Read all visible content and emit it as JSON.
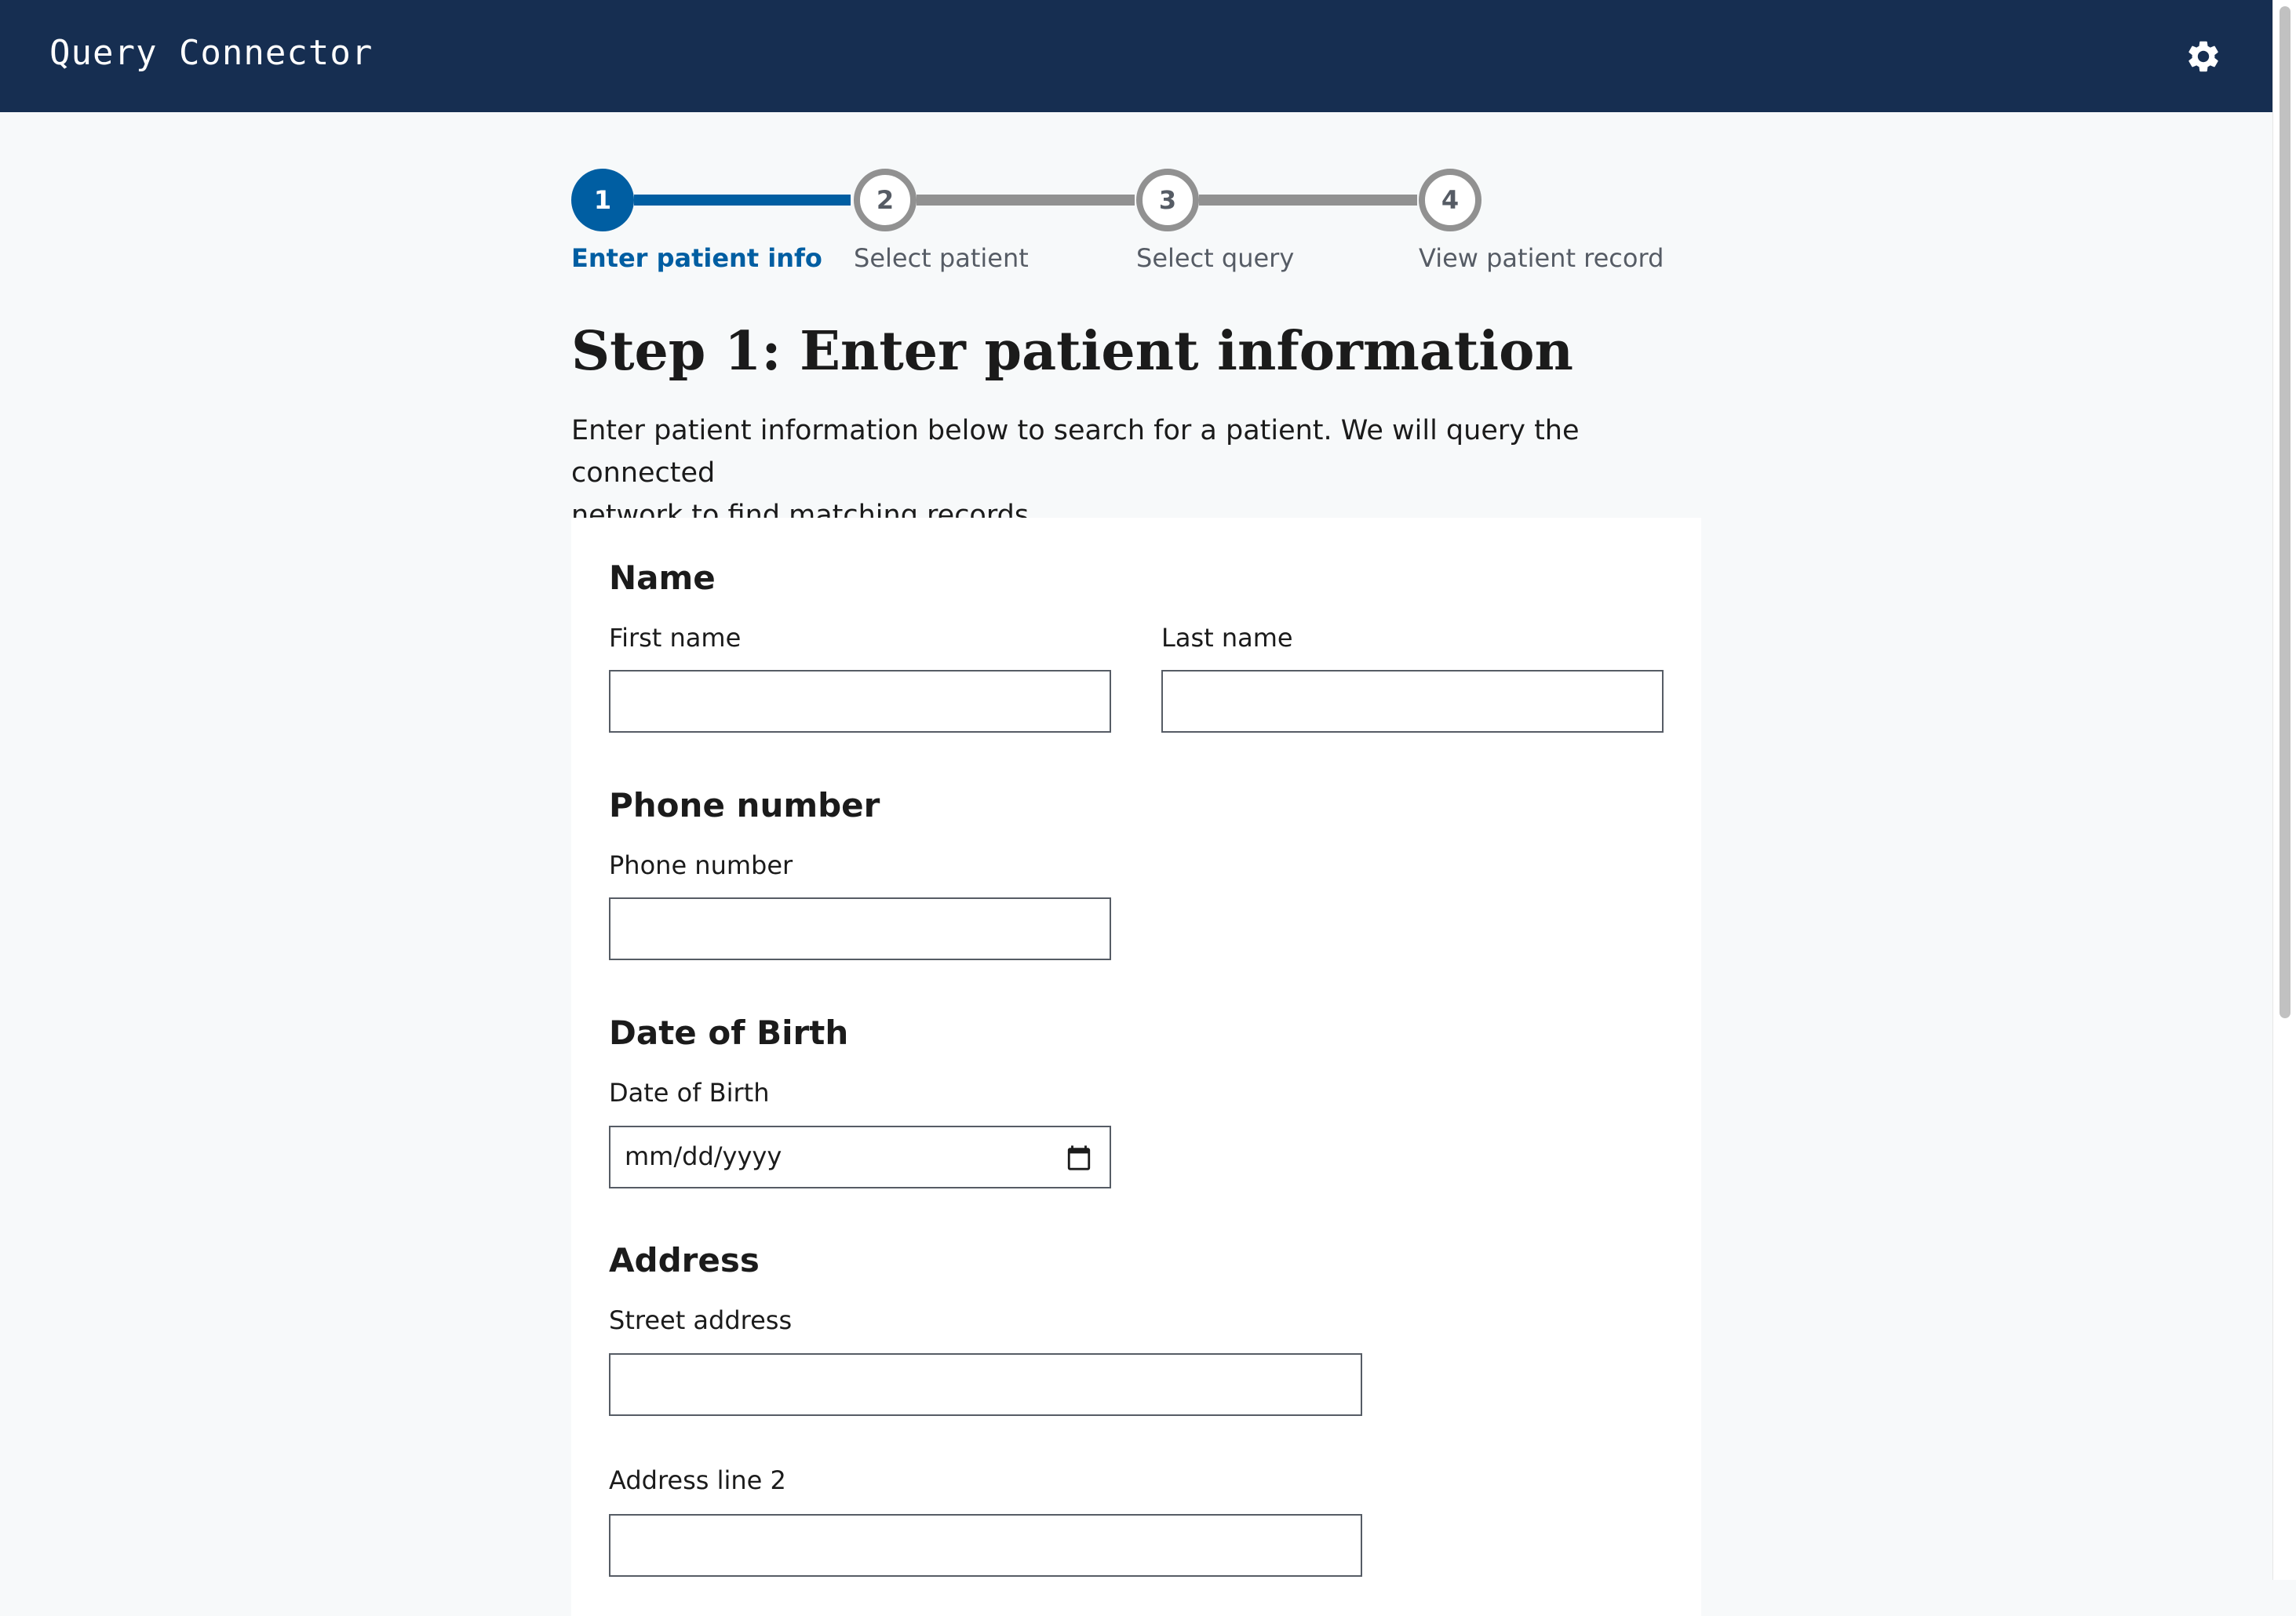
{
  "header": {
    "title": "Query Connector",
    "settings_icon": "gear-icon",
    "background_color": "#162e51"
  },
  "stepper": {
    "accent_color": "#005ea2",
    "inactive_color": "#919191",
    "steps": [
      {
        "number": "1",
        "label": "Enter patient info",
        "state": "current"
      },
      {
        "number": "2",
        "label": "Select patient",
        "state": "upcoming"
      },
      {
        "number": "3",
        "label": "Select query",
        "state": "upcoming"
      },
      {
        "number": "4",
        "label": "View patient record",
        "state": "upcoming"
      }
    ]
  },
  "page": {
    "heading": "Step 1: Enter patient information",
    "intro_line1": "Enter patient information below to search for a patient. We will query the connected",
    "intro_line2": "network to find matching records."
  },
  "form": {
    "name_section": {
      "title": "Name",
      "first_name_label": "First name",
      "first_name_value": "",
      "last_name_label": "Last name",
      "last_name_value": ""
    },
    "phone_section": {
      "title": "Phone number",
      "phone_label": "Phone number",
      "phone_value": ""
    },
    "dob_section": {
      "title": "Date of Birth",
      "dob_label": "Date of Birth",
      "dob_placeholder": "mm/dd/yyyy",
      "calendar_icon": "calendar-icon"
    },
    "address_section": {
      "title": "Address",
      "street_label": "Street address",
      "street_value": "",
      "line2_label": "Address line 2",
      "line2_value": ""
    }
  }
}
